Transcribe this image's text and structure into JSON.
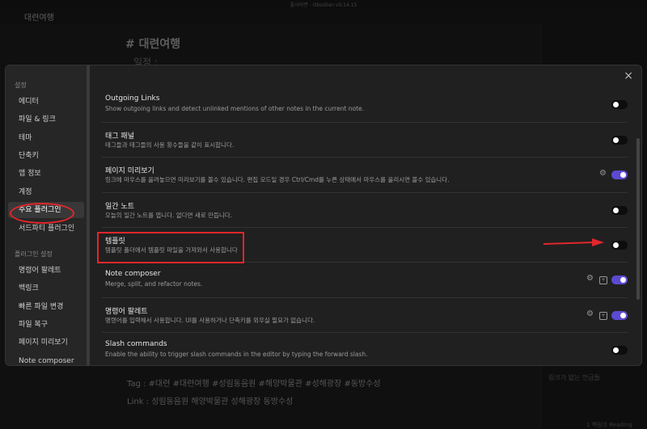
{
  "background": {
    "window_title": "좋사되면 - Obsidian v0.14.15",
    "tab_title": "대련여행",
    "doc_heading": "# 대련여행",
    "doc_sub": "일정 :",
    "tags_line": "Tag : #대련 #대련여행 #성림동음원 #해양박물관 #성해광장 #동방수성",
    "links_line": "Link : 성림동음원 해양박물관 성해광장 동방수성",
    "right_panel_text": "링크가 없는 언급들",
    "status_text": "1 백링크    Reading"
  },
  "settings": {
    "close_icon": "×",
    "sections": [
      {
        "header": "설정",
        "items": [
          "에디터",
          "파일 & 링크",
          "테마",
          "단축키",
          "앱 정보",
          "계정",
          "주요 플러그인",
          "서드파티 플러그인"
        ]
      },
      {
        "header": "플러그인 설정",
        "items": [
          "명령어 팔레트",
          "백링크",
          "빠른 파일 변경",
          "파일 복구",
          "페이지 미리보기",
          "Note composer"
        ]
      }
    ],
    "plugins": [
      {
        "name": "Outgoing Links",
        "desc": "Show outgoing links and detect unlinked mentions of other notes in the current note.",
        "on": false
      },
      {
        "name": "태그 패널",
        "desc": "태그들과 태그들의 사용 횟수들을 같이 표시합니다.",
        "on": false
      },
      {
        "name": "페이지 미리보기",
        "desc": "링크에 마우스를 올려놓으면 미리보기를 볼수 있습니다. 편집 모드일 경우 Ctrl/Cmd를 누른 상태에서 마우스를 올리시면 볼수 있습니다.",
        "on": true
      },
      {
        "name": "일간 노트",
        "desc": "오늘의 일간 노트를 엽니다. 없다면 새로 만듭니다.",
        "on": false
      },
      {
        "name": "템플릿",
        "desc": "템플릿 폴더에서 템플릿 파일을 가져와서 사용합니다",
        "on": false
      },
      {
        "name": "Note composer",
        "desc": "Merge, split, and refactor notes.",
        "on": true
      },
      {
        "name": "명령어 팔레트",
        "desc": "명령어를 입력해서 사용합니다. UI를 사용하거나 단축키를 외우실 필요가 없습니다.",
        "on": true
      },
      {
        "name": "Slash commands",
        "desc": "Enable the ability to trigger slash commands in the editor by typing the forward slash.",
        "on": false
      }
    ]
  },
  "colors": {
    "accent": "#5b4ad1",
    "annotation": "#e0262b"
  }
}
